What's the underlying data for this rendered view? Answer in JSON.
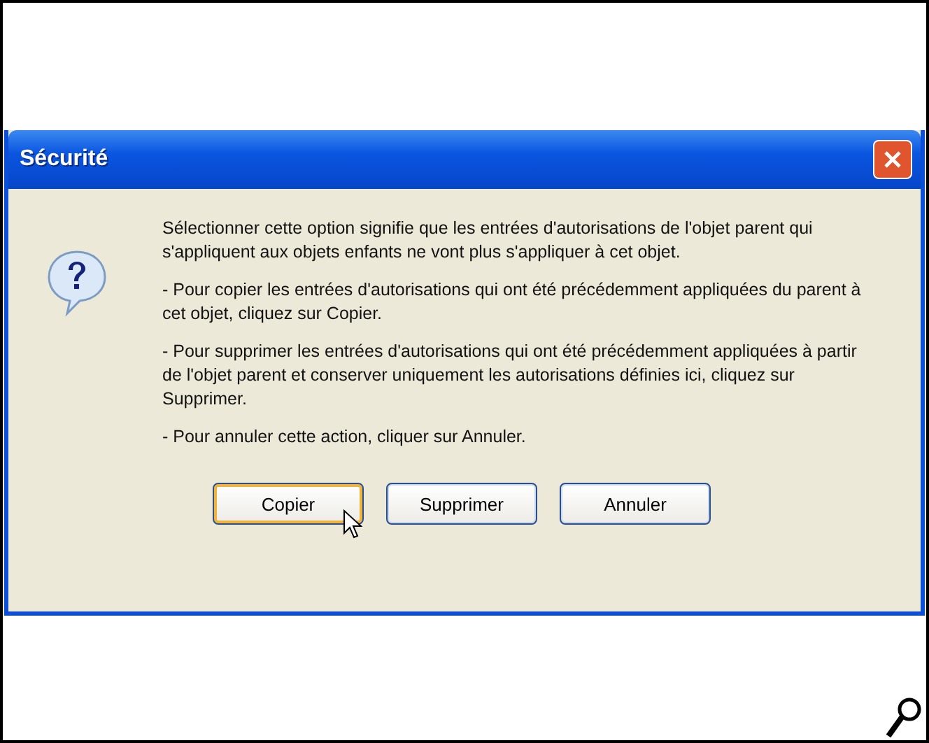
{
  "dialog": {
    "title": "Sécurité",
    "paragraphs": [
      "Sélectionner cette option signifie que les entrées d'autorisations de l'objet parent qui s'appliquent aux objets enfants ne vont plus s'appliquer à cet objet.",
      "- Pour copier les entrées d'autorisations qui ont été précédemment appliquées du parent à cet objet, cliquez sur Copier.",
      "- Pour supprimer les entrées d'autorisations qui ont été précédemment appliquées à partir de l'objet parent et conserver uniquement les autorisations définies ici, cliquez sur Supprimer.",
      "- Pour annuler cette action, cliquer sur Annuler."
    ],
    "buttons": [
      {
        "label": "Copier",
        "focused": true
      },
      {
        "label": "Supprimer",
        "focused": false
      },
      {
        "label": "Annuler",
        "focused": false
      }
    ]
  }
}
